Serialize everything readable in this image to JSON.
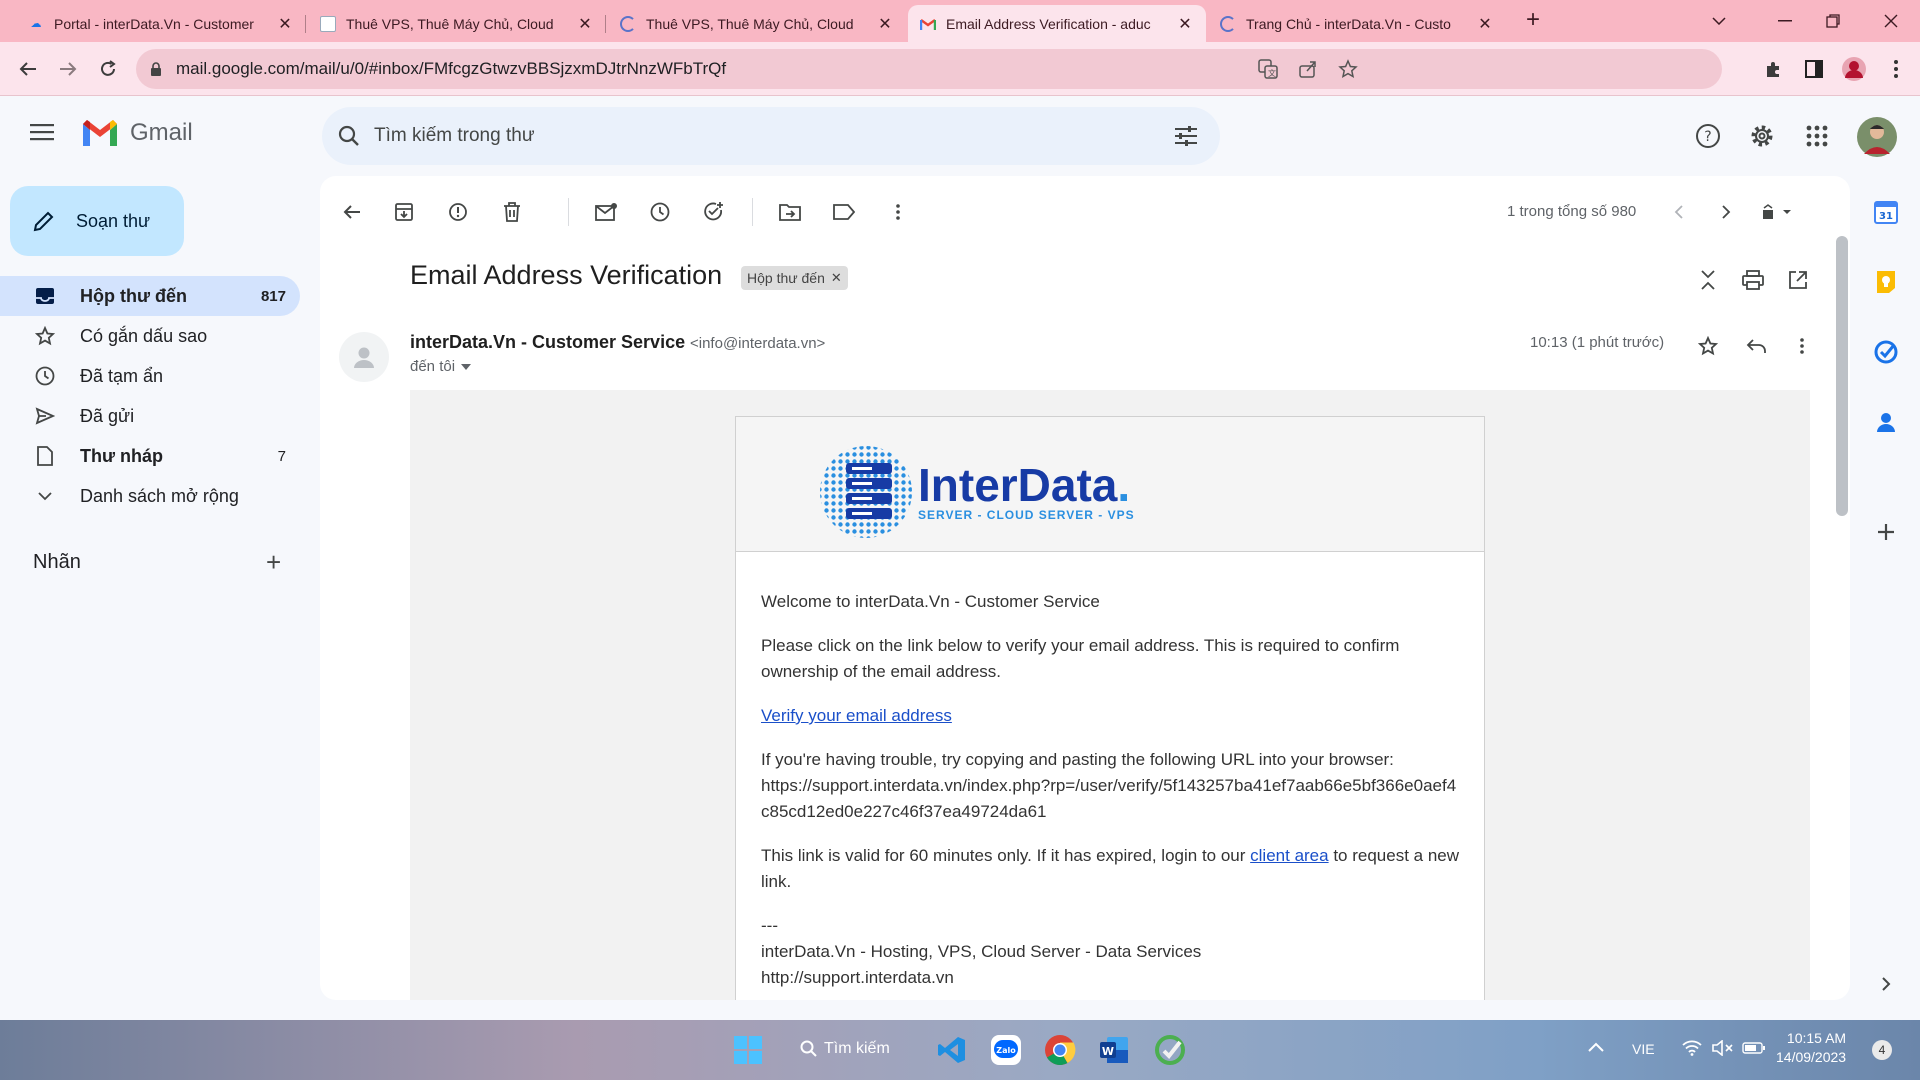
{
  "browser": {
    "tabs": [
      {
        "title": "Portal - interData.Vn - Customer",
        "favicon": "portal-icon"
      },
      {
        "title": "Thuê VPS, Thuê Máy Chủ, Cloud",
        "favicon": "page-icon"
      },
      {
        "title": "Thuê VPS, Thuê Máy Chủ, Cloud",
        "favicon": "loading-icon"
      },
      {
        "title": "Email Address Verification - aduc",
        "favicon": "gmail-icon",
        "active": true
      },
      {
        "title": "Trang Chủ - interData.Vn - Custo",
        "favicon": "loading-icon"
      }
    ],
    "url": "mail.google.com/mail/u/0/#inbox/FMfcgzGtwzvBBSjzxmDJtrNnzWFbTrQf"
  },
  "gmail": {
    "logo_text": "Gmail",
    "search_placeholder": "Tìm kiếm trong thư",
    "compose_label": "Soạn thư",
    "nav": [
      {
        "label": "Hộp thư đến",
        "count": "817",
        "icon": "inbox-icon",
        "selected": true
      },
      {
        "label": "Có gắn dấu sao",
        "count": "",
        "icon": "star-icon"
      },
      {
        "label": "Đã tạm ẩn",
        "count": "",
        "icon": "clock-icon"
      },
      {
        "label": "Đã gửi",
        "count": "",
        "icon": "send-icon"
      },
      {
        "label": "Thư nháp",
        "count": "7",
        "icon": "draft-icon",
        "bold": true
      },
      {
        "label": "Danh sách mở rộng",
        "count": "",
        "icon": "chevron-down-icon"
      }
    ],
    "labels_title": "Nhãn",
    "pager": "1 trong tổng số 980"
  },
  "email": {
    "subject": "Email Address Verification",
    "chip": "Hộp thư đến",
    "sender_name": "interData.Vn - Customer Service",
    "sender_email": "<info@interdata.vn>",
    "to": "đến tôi",
    "time": "10:13 (1 phút trước)",
    "brand_name": "InterData",
    "brand_dot": ".",
    "brand_tagline": "SERVER - CLOUD SERVER - VPS",
    "welcome": "Welcome to interData.Vn - Customer Service",
    "instruction": "Please click on the link below to verify your email address. This is required to confirm ownership of the email address.",
    "verify_link": "Verify your email address",
    "trouble": "If you're having trouble, try copying and pasting the following URL into your browser:",
    "verify_url": "https://support.interdata.vn/index.php?rp=/user/verify/5f143257ba41ef7aab66e5bf366e0aef4c85cd12ed0e227c46f37ea49724da61",
    "validity_pre": "This link is valid for 60 minutes only. If it has expired, login to our",
    "client_area": "client area",
    "validity_post": "to request a new link.",
    "sig_dash": "---",
    "sig_company": "interData.Vn - Hosting, VPS, Cloud Server - Data Services",
    "sig_url": "http://support.interdata.vn"
  },
  "taskbar": {
    "search_label": "Tìm kiếm",
    "language": "VIE",
    "time": "10:15 AM",
    "date": "14/09/2023",
    "notifications": "4"
  },
  "colors": {
    "tab_strip": "#f9b7c4",
    "toolbar": "#fce4ec",
    "inbox_selected": "#d3e3fd",
    "compose": "#c2e7ff",
    "brand_blue": "#173ba5",
    "link": "#1a4fc9"
  }
}
